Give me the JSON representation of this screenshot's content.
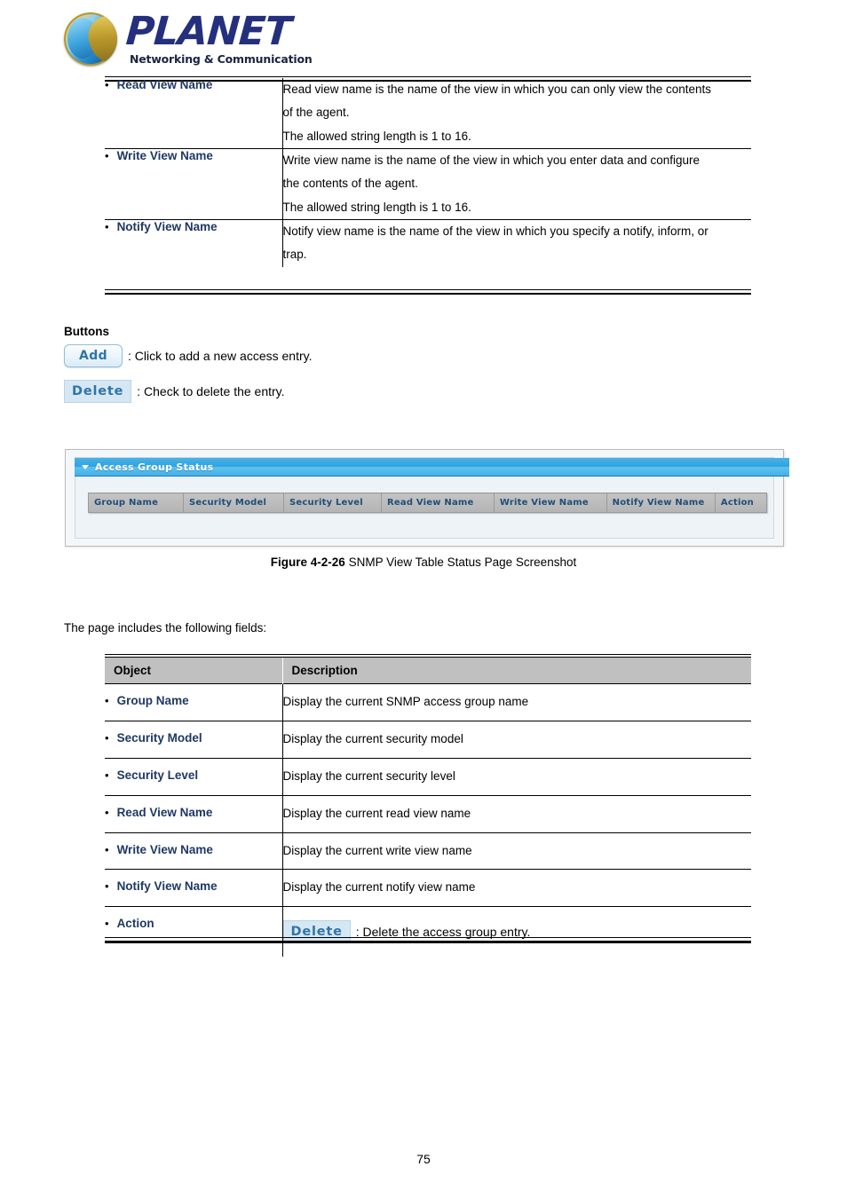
{
  "brand": {
    "name": "PLANET",
    "tagline": "Networking & Communication",
    "logo_blue": "#24307e",
    "logo_gold": "#c9a227"
  },
  "top_table": {
    "rows": [
      {
        "object": "Read View Name",
        "description_lines": [
          "Read view name is the name of the view in which you can only view the contents",
          "of the agent.",
          "The allowed string length is 1 to 16."
        ]
      },
      {
        "object": "Write View Name",
        "description_lines": [
          "Write view name is the name of the view in which you enter data and configure",
          "the contents of the agent.",
          "The allowed string length is 1 to 16."
        ]
      },
      {
        "object": "Notify View Name",
        "description_lines": [
          "Notify view name is the name of the view in which you specify a notify, inform, or",
          "trap."
        ]
      }
    ]
  },
  "buttons_section": {
    "heading": "Buttons",
    "add_label": "Add",
    "add_caption": ": Click to add a new access entry.",
    "delete_label": "Delete",
    "delete_caption": ": Check to delete the entry."
  },
  "screenshot": {
    "panel_title": "Access Group Status",
    "caret_icon": "triangle-down-icon",
    "columns": [
      "Group Name",
      "Security Model",
      "Security Level",
      "Read View Name",
      "Write View Name",
      "Notify View Name",
      "Action"
    ],
    "header_bg": "#b4b4b4",
    "header_text_color": "#1f4e79",
    "title_bar_color": "#2ea2e0"
  },
  "figure": {
    "number": "Figure 4-2-26",
    "title": " SNMP View Table Status Page Screenshot"
  },
  "intro_line": "The page includes the following fields:",
  "bottom_table": {
    "headers": {
      "object": "Object",
      "description": "Description"
    },
    "rows": [
      {
        "object": "Group Name",
        "description": "Display the current SNMP access group name"
      },
      {
        "object": "Security Model",
        "description": "Display the current security model"
      },
      {
        "object": "Security Level",
        "description": "Display the current security level"
      },
      {
        "object": "Read View Name",
        "description": "Display the current read view name"
      },
      {
        "object": "Write View Name",
        "description": "Display the current write view name"
      },
      {
        "object": "Notify View Name",
        "description": "Display the current notify view name"
      }
    ],
    "action_row": {
      "object": "Action",
      "button_label": "Delete",
      "caption": ": Delete the access group entry."
    }
  },
  "page_number": "75"
}
